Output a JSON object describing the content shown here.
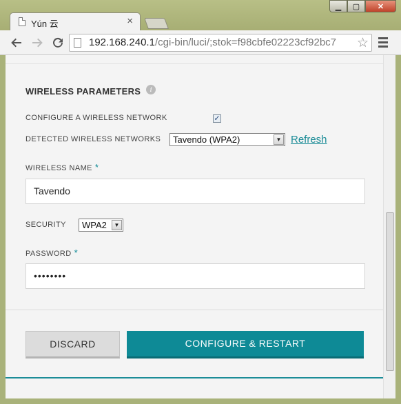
{
  "browser": {
    "tab_title": "Yún 云",
    "tab_close": "×",
    "url_host": "192.168.240.1",
    "url_path": "/cgi-bin/luci/;stok=f98cbfe02223cf92bc7",
    "window_min": "▁",
    "window_max": "▢",
    "window_close": "✕"
  },
  "form": {
    "section_title": "WIRELESS PARAMETERS",
    "configure_label": "CONFIGURE A WIRELESS NETWORK",
    "configure_checked": true,
    "detected_label": "DETECTED WIRELESS NETWORKS",
    "detected_value": "Tavendo (WPA2)",
    "refresh_label": "Refresh",
    "wireless_name_label": "WIRELESS NAME",
    "wireless_name_value": "Tavendo",
    "required_mark": "*",
    "security_label": "SECURITY",
    "security_value": "WPA2",
    "password_label": "PASSWORD",
    "password_value": "••••••••",
    "discard_label": "DISCARD",
    "configure_restart_label": "CONFIGURE & RESTART"
  },
  "colors": {
    "accent": "#0e8a96"
  },
  "icons": [
    "page-icon",
    "back-icon",
    "forward-icon",
    "reload-icon",
    "star-icon",
    "menu-icon",
    "info-icon",
    "checkmark-icon",
    "dropdown-arrow-icon"
  ]
}
